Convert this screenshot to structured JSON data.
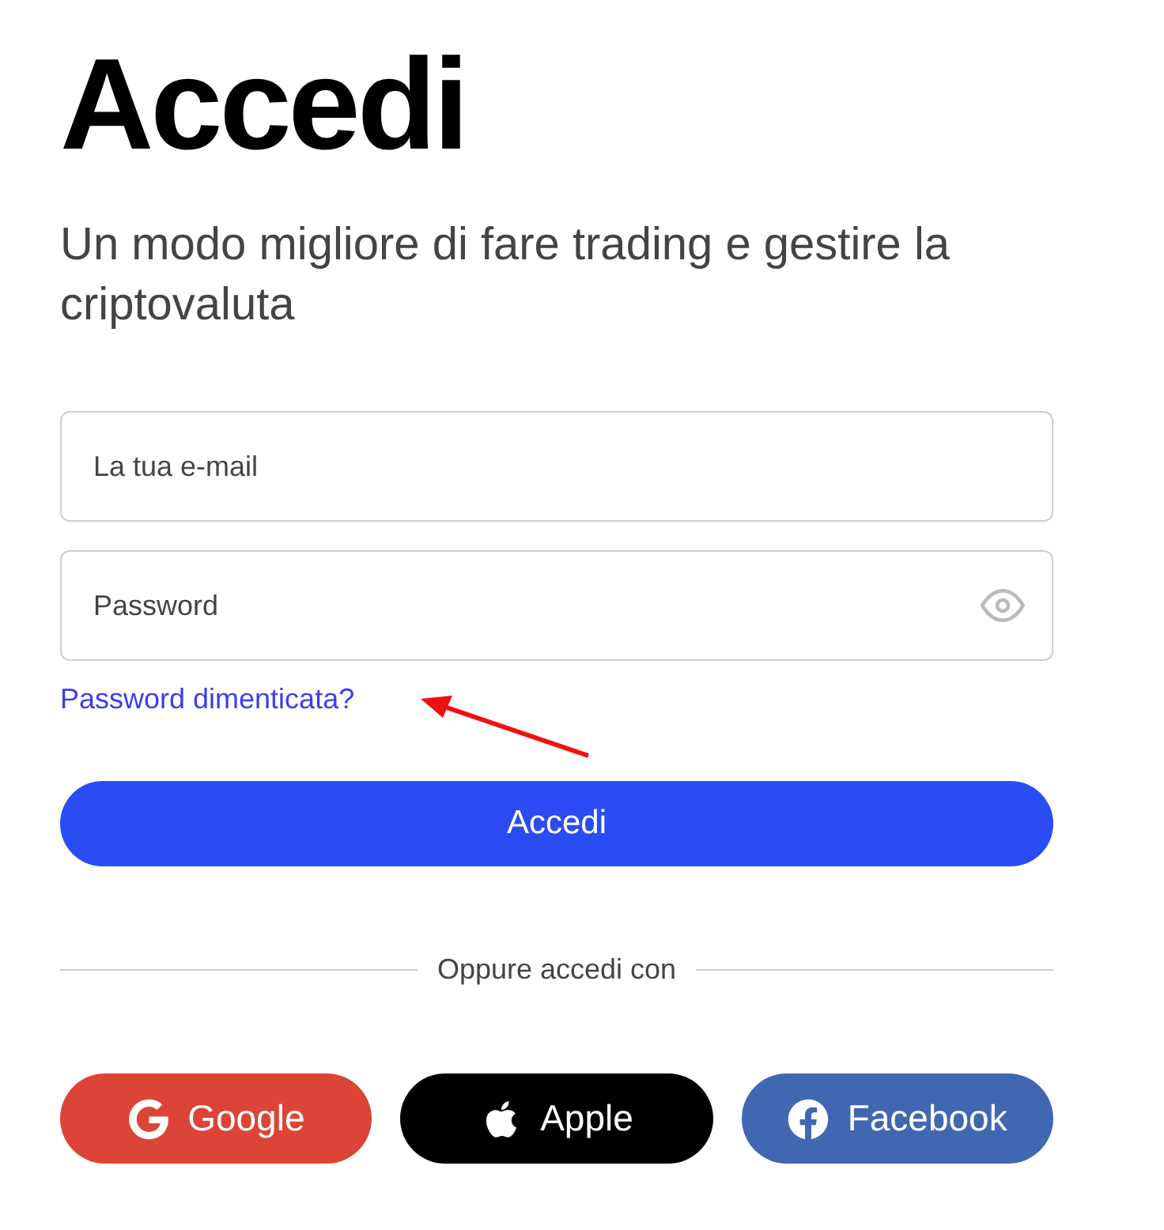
{
  "title": "Accedi",
  "subtitle": "Un modo migliore di fare trading e gestire la criptovaluta",
  "fields": [
    {
      "kind": "email",
      "placeholder": "La tua e-mail"
    },
    {
      "kind": "password",
      "placeholder": "Password"
    }
  ],
  "forgot_link": "Password dimenticata?",
  "submit_button": "Accedi",
  "divider_text": "Oppure accedi con",
  "social_buttons": [
    {
      "kind": "google",
      "label": "Google",
      "color": "#db4437"
    },
    {
      "kind": "apple",
      "label": "Apple",
      "color": "#000000"
    },
    {
      "kind": "facebook",
      "label": "Facebook",
      "color": "#4267b2"
    }
  ]
}
